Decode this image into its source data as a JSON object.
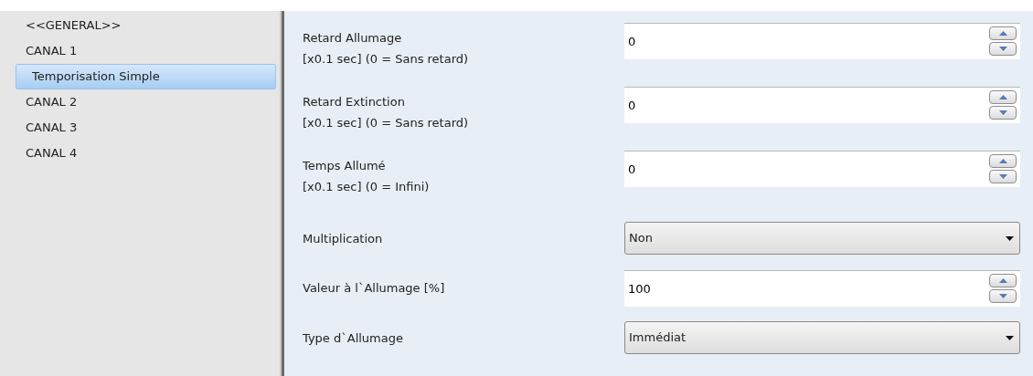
{
  "sidebar": {
    "items": [
      {
        "label": "<<GENERAL>>",
        "selected": false
      },
      {
        "label": "CANAL 1",
        "selected": false,
        "children": [
          {
            "label": "Temporisation Simple",
            "selected": true
          }
        ]
      },
      {
        "label": "CANAL 2",
        "selected": false
      },
      {
        "label": "CANAL 3",
        "selected": false
      },
      {
        "label": "CANAL 4",
        "selected": false
      }
    ]
  },
  "parameters": [
    {
      "kind": "spin",
      "label": "Retard Allumage",
      "note": "[x0.1 sec] (0 = Sans retard)",
      "value": "0"
    },
    {
      "kind": "spin",
      "label": "Retard Extinction",
      "note": "[x0.1 sec] (0 = Sans retard)",
      "value": "0"
    },
    {
      "kind": "spin",
      "label": "Temps Allumé",
      "note": "[x0.1 sec] (0 = Infini)",
      "value": "0"
    },
    {
      "kind": "select",
      "label": "Multiplication",
      "value": "Non"
    },
    {
      "kind": "spin",
      "label": "Valeur à l`Allumage [%]",
      "value": "100"
    },
    {
      "kind": "select",
      "label": "Type d`Allumage",
      "value": "Immédiat"
    }
  ]
}
